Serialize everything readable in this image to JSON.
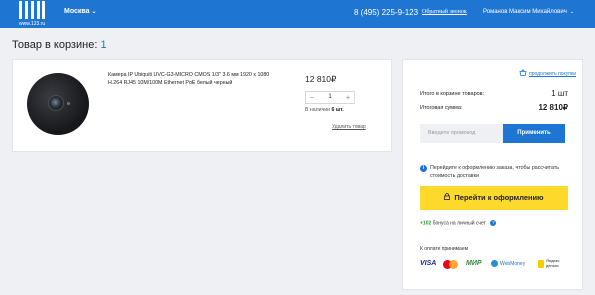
{
  "header": {
    "logo_text": "www.123.ru",
    "city": "Москва",
    "phone": "8 (495) 225-9-123",
    "callback": "Обратный звонок",
    "user": "Романов Максим Михайлович"
  },
  "page": {
    "title": "Товар в корзине:",
    "count": "1"
  },
  "item": {
    "name": "Камера IP Ubiquiti UVC-G3-MICRO CMOS 1/3\" 3.6 мм 1920 x 1080 H.264 RJ45 10M/100M Ethernet PoE белый черный",
    "price": "12 810₽",
    "minus": "−",
    "plus": "+",
    "quantity": "1",
    "stock_prefix": "В наличии",
    "stock_value": "6 шт.",
    "remove": "Удалить товар"
  },
  "summary": {
    "continue": "продолжить покупки",
    "total_items_label": "Итого в корзине товаров:",
    "total_items_value": "1 шт",
    "total_sum_label": "Итоговая сумма:",
    "total_sum_value": "12 810₽",
    "promo_placeholder": "Введите промокод",
    "apply": "Применить",
    "info_icon": "i",
    "info": "Перейдите к оформлению заказа, чтобы рассчитать стоимость доставки",
    "checkout": "Перейти к оформлению",
    "bonus_amount": "+102",
    "bonus_text": "бонуса на личный счет",
    "bonus_help": "?",
    "accept": "К оплате принимаем",
    "payments": {
      "visa": "VISA",
      "mir": "МИР",
      "webmoney": "WebMoney",
      "yandex": "Яндекс деньги"
    }
  },
  "colors": {
    "brand": "#1f76d2",
    "checkout": "#fcd92a",
    "bonus": "#2b9b3a"
  }
}
